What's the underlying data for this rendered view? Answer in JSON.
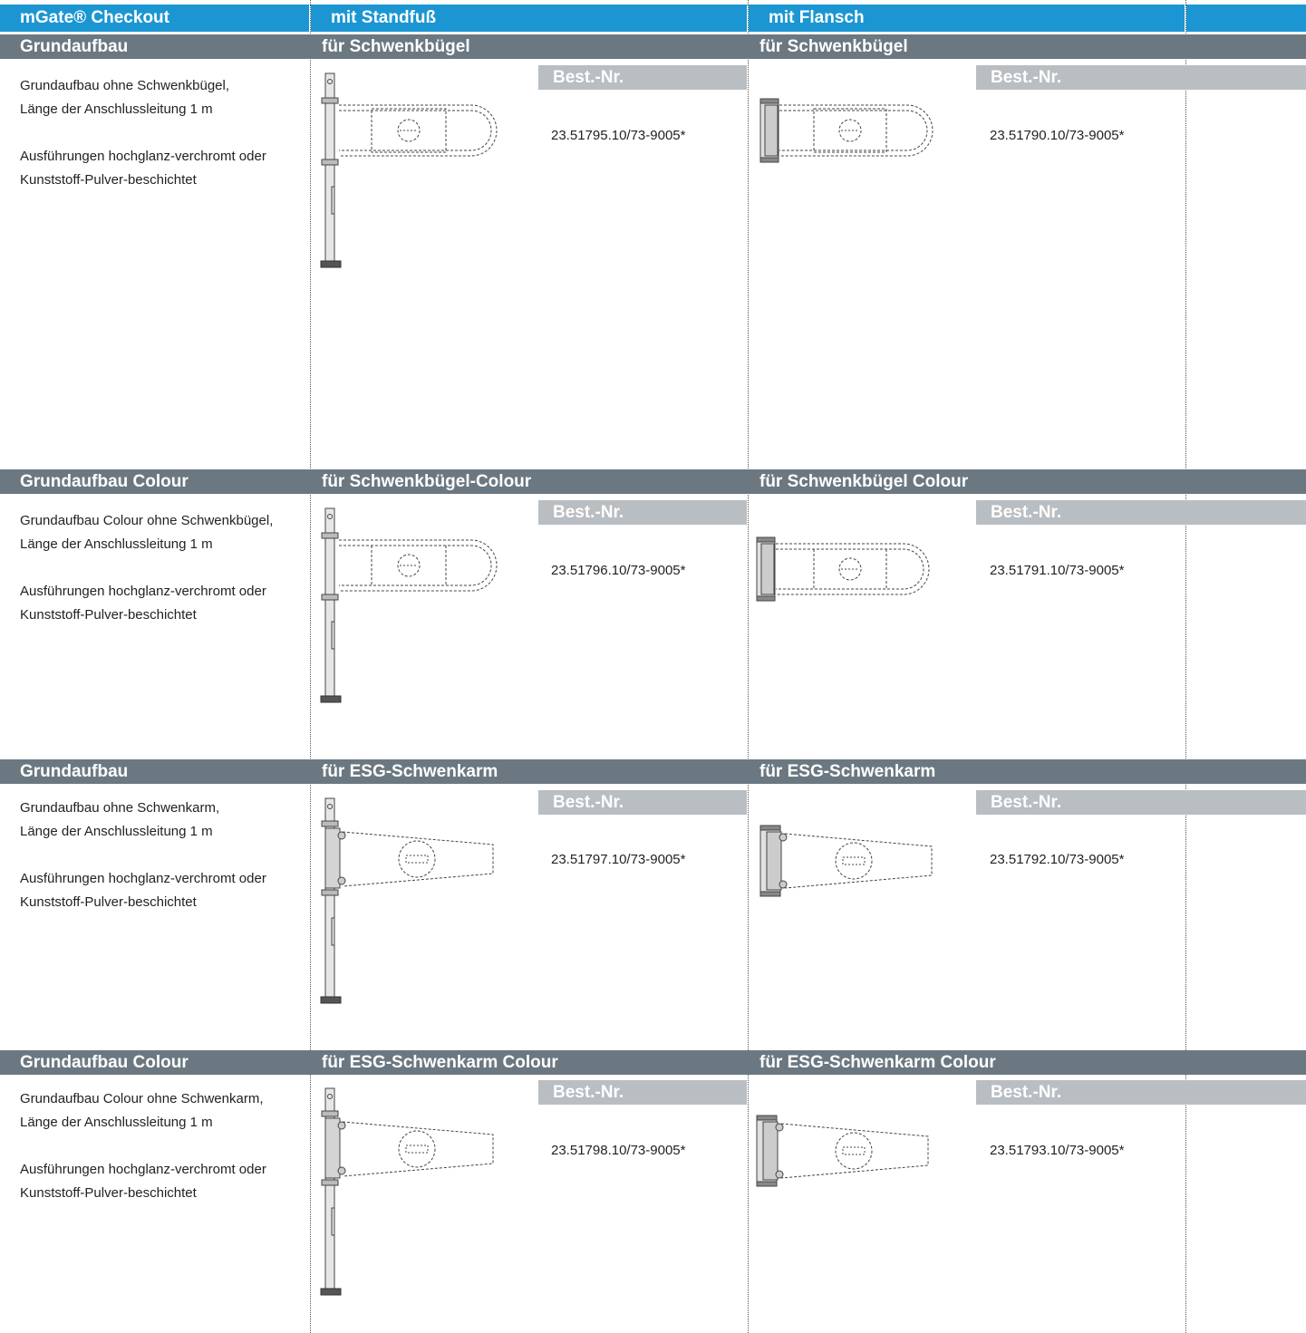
{
  "header": {
    "col1": "mGate® Checkout",
    "col2": "mit Standfuß",
    "col3": "mit Flansch"
  },
  "best_nr_label": "Best.-Nr.",
  "sections": [
    {
      "title": "Grundaufbau",
      "standfuss_title": "für Schwenkbügel",
      "flansch_title": "für Schwenkbügel",
      "desc_line1": "Grundaufbau ohne Schwenkbügel,",
      "desc_line2": "Länge der Anschlussleitung 1 m",
      "desc_line3": "Ausführungen hochglanz-verchromt oder",
      "desc_line4": "Kunststoff-Pulver-beschichtet",
      "standfuss_artno": "23.51795.10/73-9005*",
      "flansch_artno": "23.51790.10/73-9005*",
      "arm_type": "buegel"
    },
    {
      "title": "Grundaufbau Colour",
      "standfuss_title": "für Schwenkbügel-Colour",
      "flansch_title": "für Schwenkbügel Colour",
      "desc_line1": "Grundaufbau Colour ohne Schwenkbügel,",
      "desc_line2": "Länge der Anschlussleitung 1 m",
      "desc_line3": "Ausführungen hochglanz-verchromt oder",
      "desc_line4": "Kunststoff-Pulver-beschichtet",
      "standfuss_artno": "23.51796.10/73-9005*",
      "flansch_artno": "23.51791.10/73-9005*",
      "arm_type": "buegel"
    },
    {
      "title": "Grundaufbau",
      "standfuss_title": "für ESG-Schwenkarm",
      "flansch_title": "für ESG-Schwenkarm",
      "desc_line1": "Grundaufbau ohne Schwenkarm,",
      "desc_line2": "Länge der Anschlussleitung 1 m",
      "desc_line3": "Ausführungen hochglanz-verchromt oder",
      "desc_line4": "Kunststoff-Pulver-beschichtet",
      "standfuss_artno": "23.51797.10/73-9005*",
      "flansch_artno": "23.51792.10/73-9005*",
      "arm_type": "esg"
    },
    {
      "title": "Grundaufbau Colour",
      "standfuss_title": "für ESG-Schwenkarm Colour",
      "flansch_title": "für ESG-Schwenkarm Colour",
      "desc_line1": "Grundaufbau Colour ohne Schwenkarm,",
      "desc_line2": "Länge der Anschlussleitung 1 m",
      "desc_line3": "Ausführungen hochglanz-verchromt oder",
      "desc_line4": "Kunststoff-Pulver-beschichtet",
      "standfuss_artno": "23.51798.10/73-9005*",
      "flansch_artno": "23.51793.10/73-9005*",
      "arm_type": "esg"
    }
  ]
}
